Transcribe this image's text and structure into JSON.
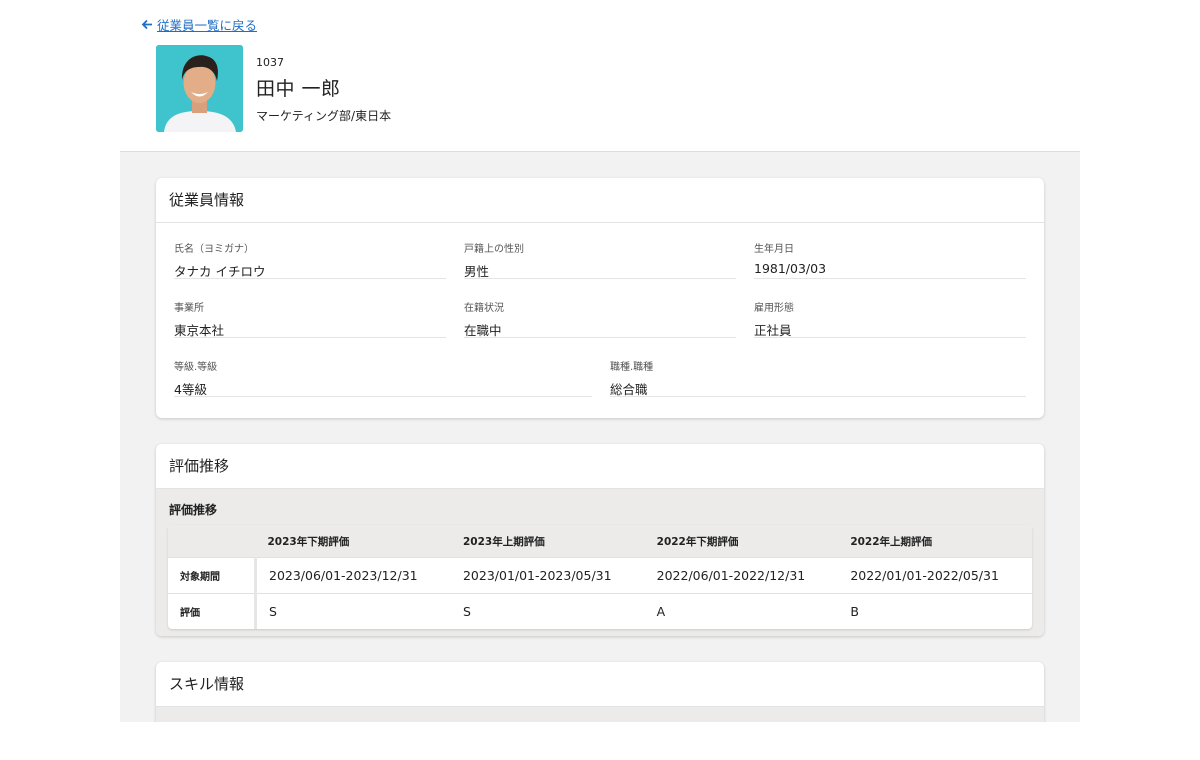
{
  "back_link": "従業員一覧に戻る",
  "profile": {
    "employee_id": "1037",
    "name": "田中 一郎",
    "department": "マーケティング部/東日本"
  },
  "employee_info": {
    "title": "従業員情報",
    "fields": [
      {
        "label": "氏名（ヨミガナ）",
        "value": "タナカ イチロウ"
      },
      {
        "label": "戸籍上の性別",
        "value": "男性"
      },
      {
        "label": "生年月日",
        "value": "1981/03/03"
      },
      {
        "label": "事業所",
        "value": "東京本社"
      },
      {
        "label": "在籍状況",
        "value": "在職中"
      },
      {
        "label": "雇用形態",
        "value": "正社員"
      },
      {
        "label": "等級.等級",
        "value": "4等級"
      },
      {
        "label": "職種.職種",
        "value": "総合職"
      }
    ]
  },
  "evaluation": {
    "card_title": "評価推移",
    "section_title": "評価推移",
    "columns": [
      "2023年下期評価",
      "2023年上期評価",
      "2022年下期評価",
      "2022年上期評価"
    ],
    "rows": [
      {
        "label": "対象期間",
        "cells": [
          "2023/06/01-2023/12/31",
          "2023/01/01-2023/05/31",
          "2022/06/01-2022/12/31",
          "2022/01/01-2022/05/31"
        ]
      },
      {
        "label": "評価",
        "cells": [
          "S",
          "S",
          "A",
          "B"
        ]
      }
    ]
  },
  "skills": {
    "title": "スキル情報"
  },
  "colors": {
    "link": "#1f6fc4",
    "avatar_background": "#3fc3cd",
    "content_background": "#f3f2f2"
  }
}
